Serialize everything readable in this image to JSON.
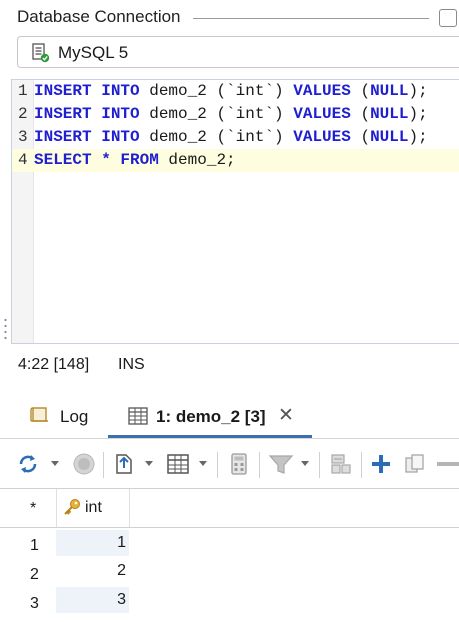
{
  "connection": {
    "legend": "Database Connection",
    "selected": "MySQL 5"
  },
  "editor": {
    "lines": [
      {
        "num": "1",
        "kw1": "INSERT",
        "kw2": "INTO",
        "t1": " demo_2 (`int`) ",
        "kw3": "VALUES",
        "t2": " (",
        "kw4": "NULL",
        "t3": ");"
      },
      {
        "num": "2",
        "kw1": "INSERT",
        "kw2": "INTO",
        "t1": " demo_2 (`int`) ",
        "kw3": "VALUES",
        "t2": " (",
        "kw4": "NULL",
        "t3": ");"
      },
      {
        "num": "3",
        "kw1": "INSERT",
        "kw2": "INTO",
        "t1": " demo_2 (`int`) ",
        "kw3": "VALUES",
        "t2": " (",
        "kw4": "NULL",
        "t3": ");"
      },
      {
        "num": "4",
        "kw1": "SELECT",
        "star": " * ",
        "kw2": "FROM",
        "t1": " demo_2;"
      }
    ]
  },
  "status": {
    "position": "4:22 [148]",
    "mode": "INS"
  },
  "tabs": {
    "log": "Log",
    "result": "1: demo_2 [3]",
    "close": "✕"
  },
  "toolbar": {
    "icons": [
      "refresh-icon",
      "stop-icon",
      "export-icon",
      "grid-view-icon",
      "calculator-icon",
      "filter-icon",
      "form-view-icon",
      "add-row-icon",
      "duplicate-row-icon",
      "delete-row-icon"
    ]
  },
  "grid": {
    "header_star": "*",
    "columns": [
      "int"
    ],
    "rows": [
      {
        "num": "1",
        "int": "1"
      },
      {
        "num": "2",
        "int": "2"
      },
      {
        "num": "3",
        "int": "3"
      }
    ]
  },
  "colors": {
    "keyword": "#1f1fd0",
    "current_line": "#fffde0",
    "tab_accent": "#3a6fb0",
    "cell_bg": "#eef3fa"
  }
}
